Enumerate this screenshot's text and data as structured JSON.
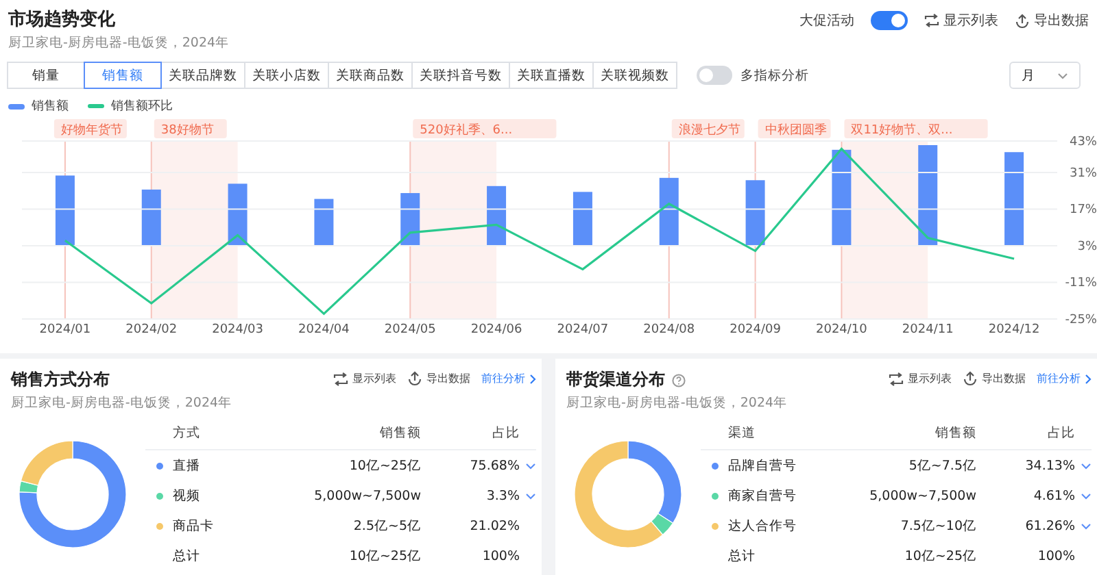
{
  "header": {
    "title": "市场趋势变化",
    "subtitle": "厨卫家电-厨房电器-电饭煲，2024年",
    "promo_toggle": {
      "label": "大促活动",
      "on": true
    },
    "actions": [
      "显示列表",
      "导出数据"
    ]
  },
  "tabs": [
    {
      "label": "销量",
      "selected": false
    },
    {
      "label": "销售额",
      "selected": true
    },
    {
      "label": "关联品牌数",
      "selected": false
    },
    {
      "label": "关联小店数",
      "selected": false
    },
    {
      "label": "关联商品数",
      "selected": false
    },
    {
      "label": "关联抖音号数",
      "selected": false
    },
    {
      "label": "关联直播数",
      "selected": false
    },
    {
      "label": "关联视频数",
      "selected": false
    }
  ],
  "multi_metric": {
    "label": "多指标分析",
    "on": false
  },
  "period_select": {
    "value": "月"
  },
  "legend": [
    {
      "label": "销售额",
      "color": "#5b8ff9"
    }
  ],
  "promo_timeline": [
    {
      "event": "好物年货节",
      "shaded": false
    },
    {
      "event": "38好物节",
      "shaded": true
    },
    {
      "shaded": false
    },
    {
      "shaded": false
    },
    {
      "event": "520好礼季、6...",
      "shaded": true
    },
    {
      "shaded": false
    },
    {
      "shaded": false
    },
    {
      "event": "浪漫七夕节",
      "shaded": false
    },
    {
      "event": "中秋团圆季",
      "shaded": false
    },
    {
      "event": "双11好物节、双...",
      "shaded": true
    },
    {
      "shaded": false
    },
    {
      "shaded": false
    }
  ],
  "trend_chart": {
    "chart_data": {
      "type": "line",
      "grid": true,
      "categories": [
        "2024/01",
        "2024/02",
        "2024/03",
        "2024/04",
        "2024/05",
        "2024/06",
        "2024/07",
        "2024/08",
        "2024/09",
        "2024/10",
        "2024/11",
        "2024/12"
      ],
      "series": [
        {
          "name": "销售额环比",
          "color": "#29c98e",
          "values": [
            5,
            -19,
            7,
            -23,
            8,
            11,
            -6,
            19,
            1,
            40,
            6,
            -2
          ]
        }
      ],
      "ylim": [
        -25,
        43
      ],
      "yticks": [
        {
          "value": 43,
          "label": "43%"
        },
        {
          "value": 31,
          "label": "31%"
        },
        {
          "value": 17,
          "label": "17%"
        },
        {
          "value": 3,
          "label": "3%"
        },
        {
          "value": -11,
          "label": "-11%"
        },
        {
          "value": -25,
          "label": "-25%"
        }
      ]
    }
  },
  "panels": [
    {
      "title": "销售方式分布",
      "help": false,
      "subtitle": "厨卫家电-厨房电器-电饭煲，2024年",
      "actions": [
        "显示列表",
        "导出数据"
      ],
      "link": "前往分析",
      "columns": [
        "方式",
        "销售额",
        "占比"
      ],
      "rows": [
        {
          "color": "#5b8ff9",
          "amount": "10亿~25亿",
          "share": "75.68%",
          "expandable": true
        },
        {
          "color": "#5ad8a6",
          "amount": "5,000w~7,500w",
          "share": "3.3%",
          "expandable": true
        },
        {
          "color": "#f6c86a",
          "amount": "2.5亿~5亿",
          "share": "21.02%",
          "expandable": false
        }
      ],
      "total": {
        "name": "总计",
        "amount": "10亿~25亿",
        "share": "100%"
      },
      "chart_data": {
        "type": "donut",
        "categories": [
          "直播",
          "视频",
          "商品卡"
        ],
        "values": [
          75.68,
          3.3,
          21.02
        ]
      }
    },
    {
      "title": "带货渠道分布",
      "help": true,
      "subtitle": "厨卫家电-厨房电器-电饭煲，2024年",
      "actions": [
        "显示列表",
        "导出数据"
      ],
      "link": "前往分析",
      "columns": [
        "渠道",
        "销售额",
        "占比"
      ],
      "rows": [
        {
          "color": "#5b8ff9",
          "amount": "5亿~7.5亿",
          "share": "34.13%",
          "expandable": true
        },
        {
          "color": "#5ad8a6",
          "amount": "5,000w~7,500w",
          "share": "4.61%",
          "expandable": true
        },
        {
          "color": "#f6c86a",
          "amount": "7.5亿~10亿",
          "share": "61.26%",
          "expandable": true
        }
      ],
      "total": {
        "name": "总计",
        "amount": "10亿~25亿",
        "share": "100%"
      },
      "chart_data": {
        "type": "donut",
        "categories": [
          "品牌自营号",
          "商家自营号",
          "达人合作号"
        ],
        "values": [
          34.13,
          4.61,
          61.26
        ]
      }
    }
  ]
}
